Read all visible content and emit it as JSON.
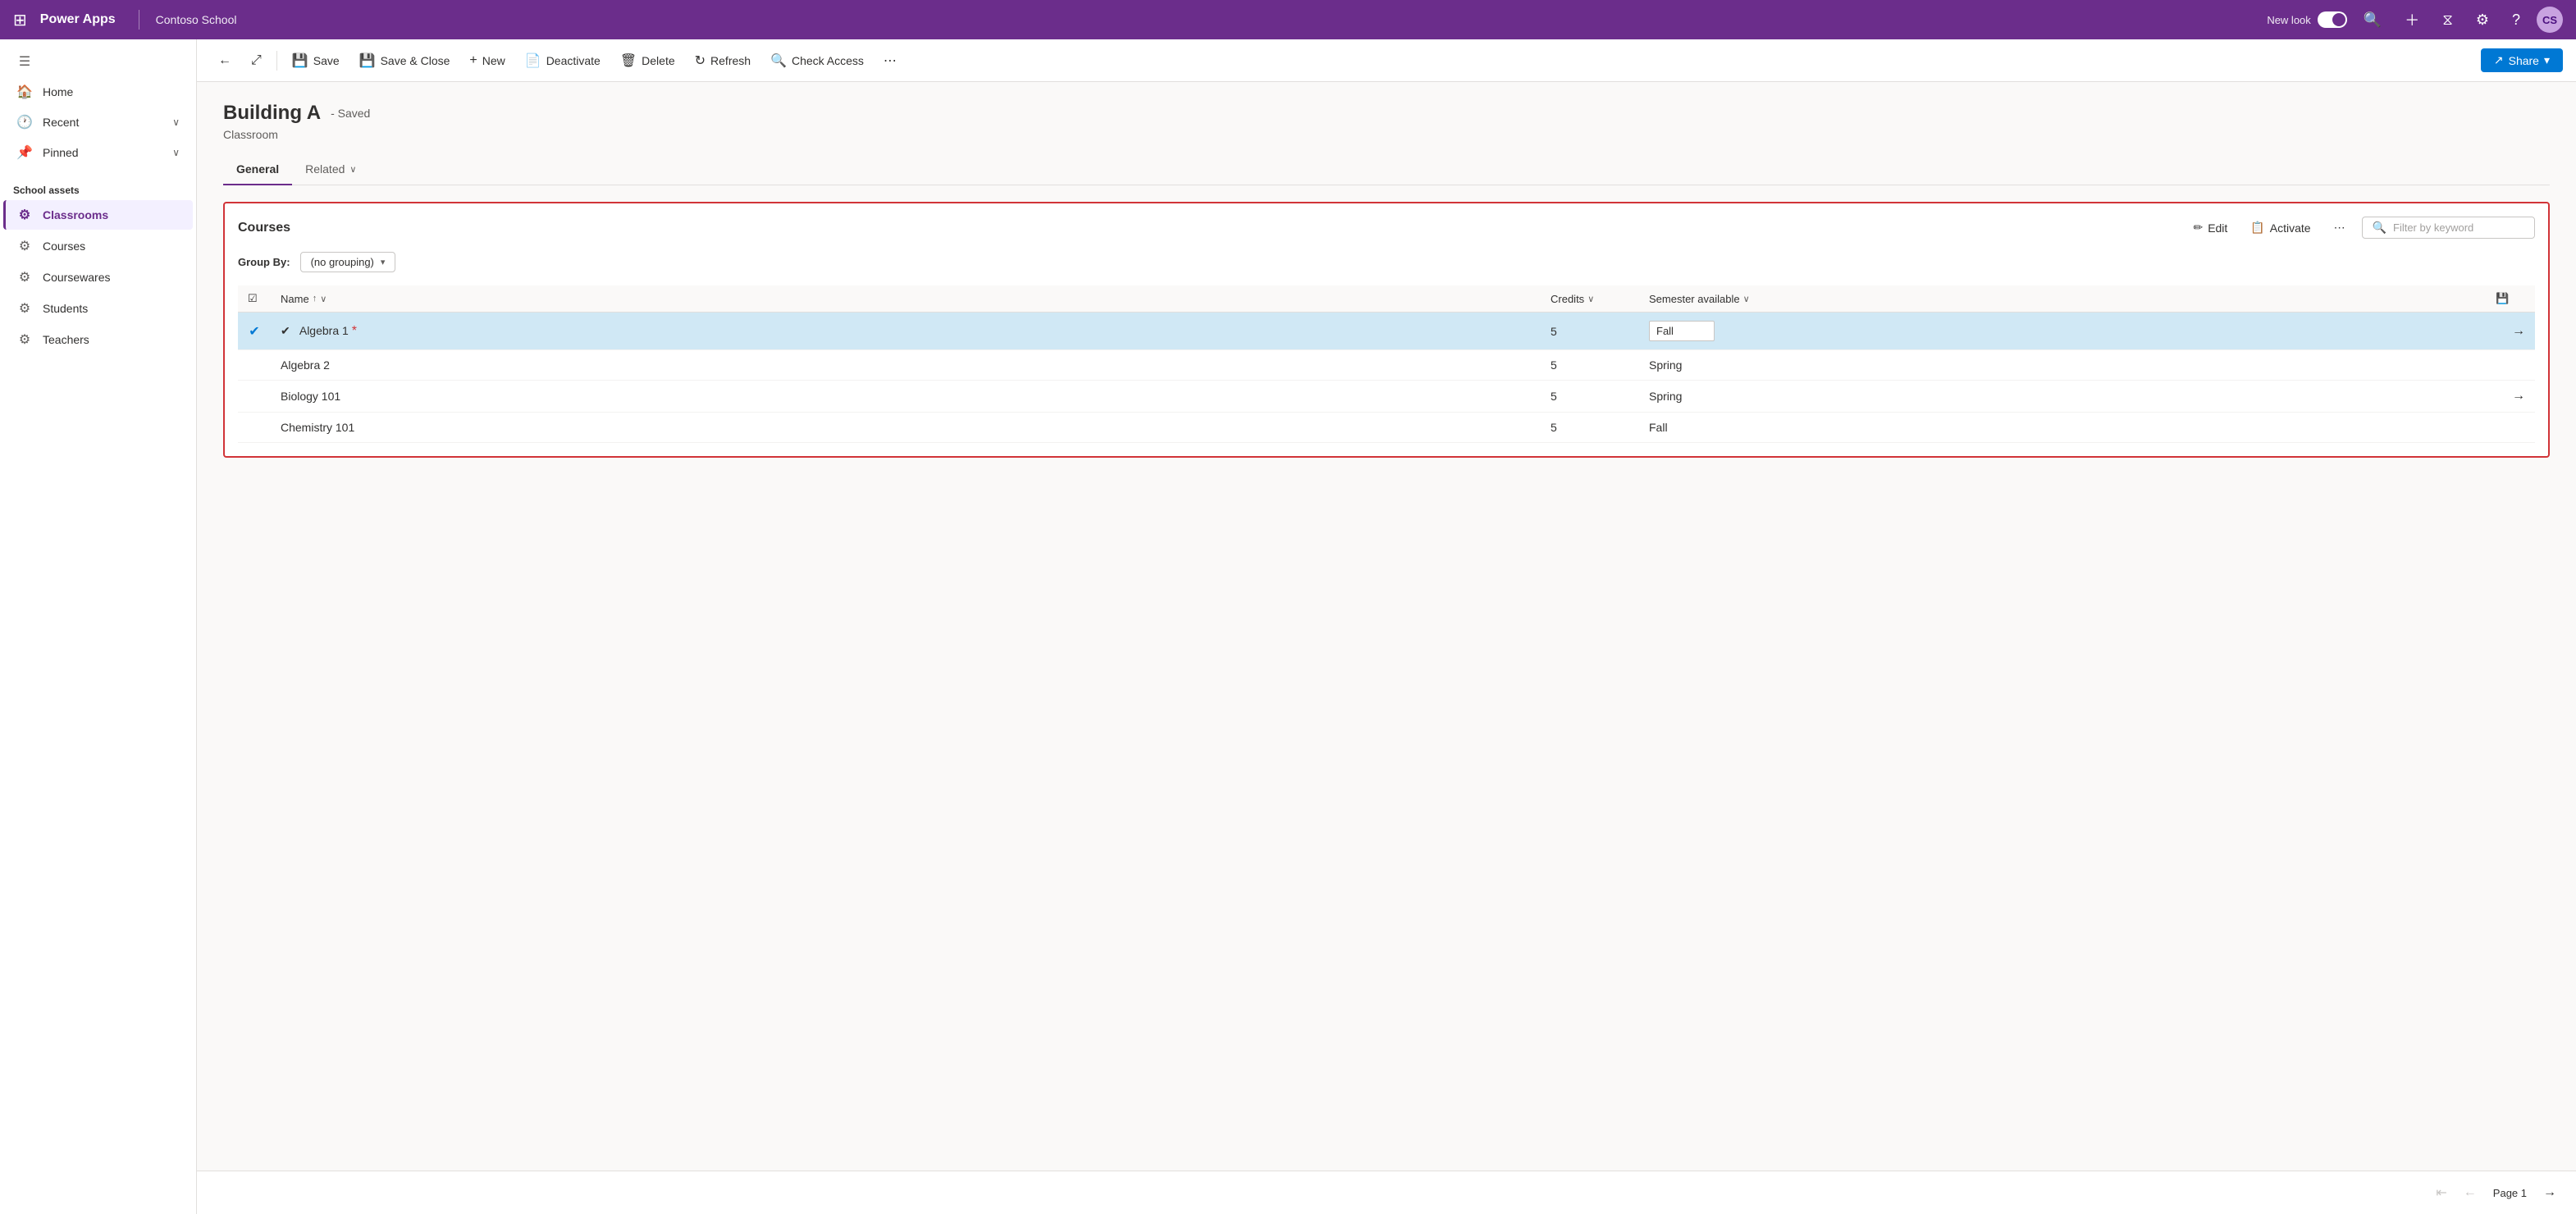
{
  "topNav": {
    "waffle": "⊞",
    "logo": "Power Apps",
    "divider": true,
    "appName": "Contoso School",
    "newLookLabel": "New look",
    "avatarInitials": "CS"
  },
  "sidebar": {
    "items": [
      {
        "id": "hamburger",
        "icon": "☰",
        "label": "",
        "type": "icon-only"
      },
      {
        "id": "home",
        "icon": "🏠",
        "label": "Home",
        "active": false
      },
      {
        "id": "recent",
        "icon": "🕐",
        "label": "Recent",
        "hasChevron": true,
        "active": false
      },
      {
        "id": "pinned",
        "icon": "📌",
        "label": "Pinned",
        "hasChevron": true,
        "active": false
      }
    ],
    "sectionLabel": "School assets",
    "schoolItems": [
      {
        "id": "classrooms",
        "icon": "⚙",
        "label": "Classrooms",
        "active": true
      },
      {
        "id": "courses",
        "icon": "⚙",
        "label": "Courses",
        "active": false
      },
      {
        "id": "coursewares",
        "icon": "⚙",
        "label": "Coursewares",
        "active": false
      },
      {
        "id": "students",
        "icon": "⚙",
        "label": "Students",
        "active": false
      },
      {
        "id": "teachers",
        "icon": "⚙",
        "label": "Teachers",
        "active": false
      }
    ]
  },
  "toolbar": {
    "backIcon": "←",
    "popoutIcon": "⤢",
    "saveLabel": "Save",
    "saveIcon": "💾",
    "saveCloseLabel": "Save & Close",
    "saveCloseIcon": "💾",
    "newLabel": "New",
    "newIcon": "+",
    "deactivateLabel": "Deactivate",
    "deactivateIcon": "📄",
    "deleteLabel": "Delete",
    "deleteIcon": "🗑",
    "refreshLabel": "Refresh",
    "refreshIcon": "↻",
    "checkAccessLabel": "Check Access",
    "checkAccessIcon": "🔍",
    "moreIcon": "⋯",
    "shareLabel": "Share",
    "shareIcon": "↗"
  },
  "page": {
    "title": "Building A",
    "savedBadge": "- Saved",
    "subtitle": "Classroom",
    "tabs": [
      {
        "id": "general",
        "label": "General",
        "active": true
      },
      {
        "id": "related",
        "label": "Related",
        "active": false,
        "hasChevron": true
      }
    ]
  },
  "coursesPanel": {
    "title": "Courses",
    "editIcon": "✏",
    "editLabel": "Edit",
    "activateIcon": "📋",
    "activateLabel": "Activate",
    "moreIcon": "⋯",
    "filterPlaceholder": "Filter by keyword",
    "filterIcon": "🔍",
    "groupByLabel": "Group By:",
    "groupByValue": "(no grouping)",
    "groupByChevron": "▾",
    "columns": [
      {
        "id": "name",
        "label": "Name",
        "sortIcon": "↑",
        "hasChevron": true
      },
      {
        "id": "credits",
        "label": "Credits",
        "hasChevron": true
      },
      {
        "id": "semester",
        "label": "Semester available",
        "hasChevron": true
      }
    ],
    "rows": [
      {
        "id": 1,
        "name": "Algebra 1",
        "credits": 5,
        "semester": "Fall",
        "selected": true,
        "hasArrow": true,
        "hasAsterisk": true,
        "semesterEditable": true
      },
      {
        "id": 2,
        "name": "Algebra 2",
        "credits": 5,
        "semester": "Spring",
        "selected": false,
        "hasArrow": false,
        "hasAsterisk": false,
        "semesterEditable": false
      },
      {
        "id": 3,
        "name": "Biology 101",
        "credits": 5,
        "semester": "Spring",
        "selected": false,
        "hasArrow": true,
        "hasAsterisk": false,
        "semesterEditable": false
      },
      {
        "id": 4,
        "name": "Chemistry 101",
        "credits": 5,
        "semester": "Fall",
        "selected": false,
        "hasArrow": false,
        "hasAsterisk": false,
        "semesterEditable": false
      }
    ]
  },
  "pagination": {
    "firstIcon": "⇤",
    "prevIcon": "←",
    "pageLabel": "Page 1",
    "nextIcon": "→"
  }
}
